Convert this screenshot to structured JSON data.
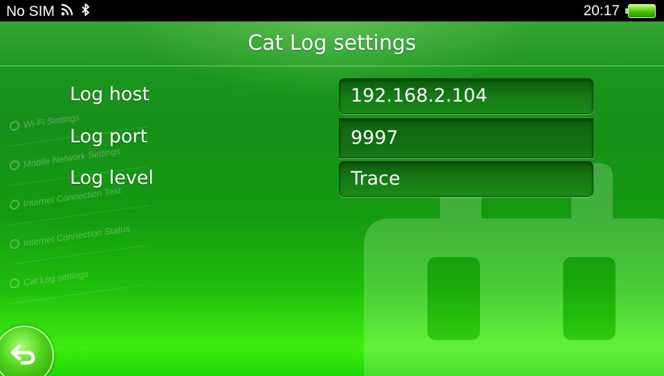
{
  "status_bar": {
    "carrier": "No SIM",
    "time": "20:17",
    "icons": [
      "wifi-signal-icon",
      "bluetooth-icon",
      "battery-icon"
    ],
    "battery_level": 1.0
  },
  "header": {
    "title": "Cat Log settings"
  },
  "form": {
    "fields": [
      {
        "label": "Log host",
        "value": "192.168.2.104"
      },
      {
        "label": "Log port",
        "value": "9997"
      },
      {
        "label": "Log level",
        "value": "Trace"
      }
    ]
  },
  "background_menu": {
    "items": [
      "Wi-Fi Settings",
      "Mobile Network Settings",
      "Internet Connection Test",
      "Internet Connection Status",
      "Cat Log settings"
    ]
  },
  "colors": {
    "accent": "#1fbd0b",
    "field_bg": "#167a14"
  },
  "icons": {
    "back": "back-arrow-icon",
    "background": "toolbox-icon"
  }
}
